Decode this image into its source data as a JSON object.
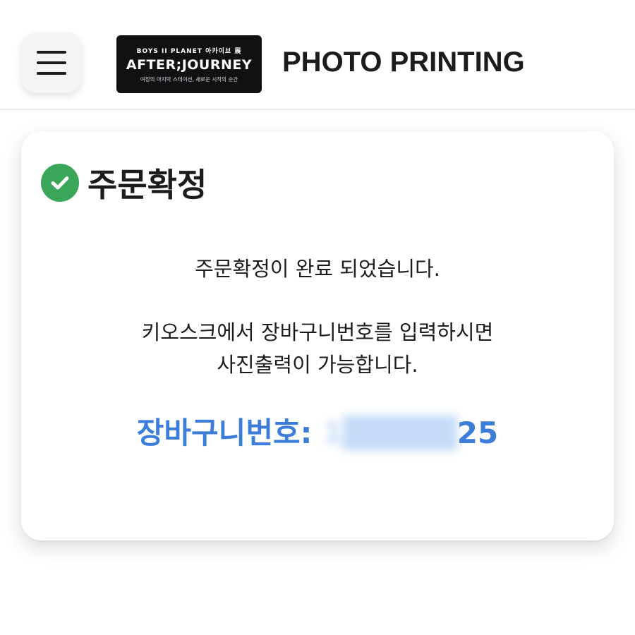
{
  "header": {
    "menu_icon": "hamburger-menu-icon",
    "logo": {
      "line1": "BOYS II PLANET 아카이브 展",
      "line2": "AFTER;JOURNEY",
      "line3": "여정의 마지막 스테이션, 새로운 시작의 순간"
    },
    "title": "PHOTO PRINTING"
  },
  "card": {
    "status_icon": "check-circle-icon",
    "heading": "주문확정",
    "message_1": "주문확정이 완료 되었습니다.",
    "message_2_line1": "키오스크에서 장바구니번호를 입력하시면",
    "message_2_line2": "사진출력이 가능합니다.",
    "cart_label": "장바구니번호:",
    "cart_number_hidden": "1",
    "cart_number_visible": "25"
  },
  "colors": {
    "accent_blue": "#3b7dd8",
    "check_green": "#3aa659",
    "logo_bg": "#111114"
  }
}
